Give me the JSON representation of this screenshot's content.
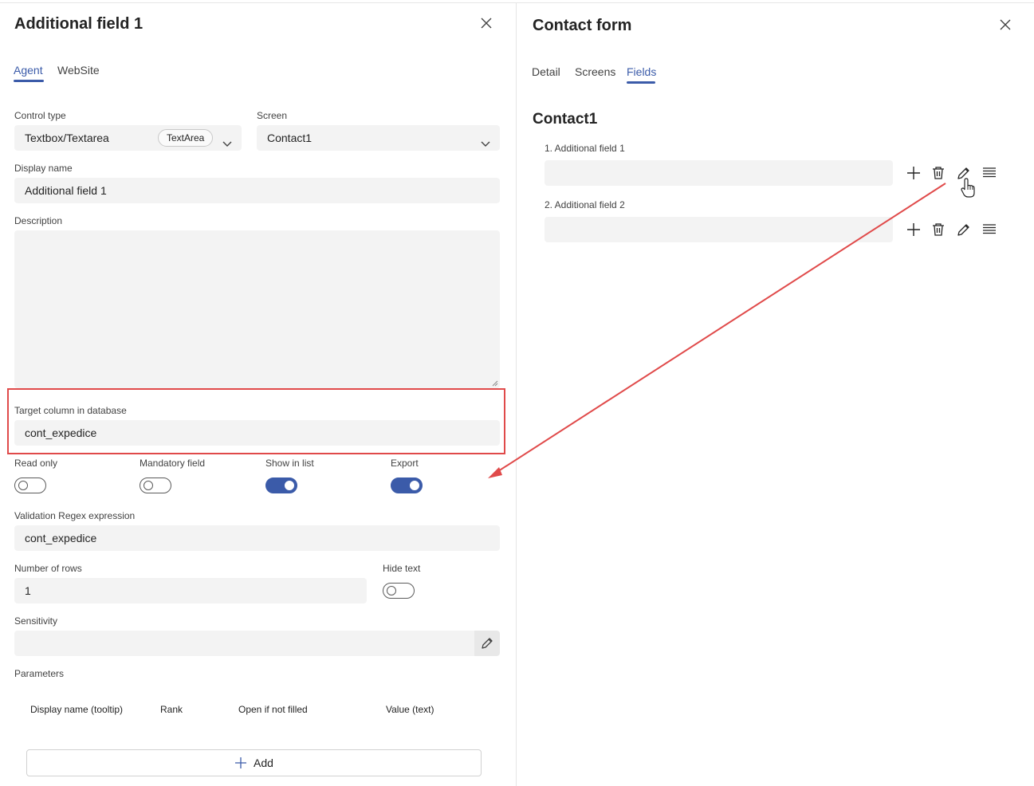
{
  "left_panel": {
    "title": "Additional field 1",
    "tabs": [
      {
        "label": "Agent",
        "active": true
      },
      {
        "label": "WebSite",
        "active": false
      }
    ],
    "control_type": {
      "label": "Control type",
      "value": "Textbox/Textarea",
      "chip": "TextArea"
    },
    "screen": {
      "label": "Screen",
      "value": "Contact1"
    },
    "display_name": {
      "label": "Display name",
      "value": "Additional field 1"
    },
    "description": {
      "label": "Description",
      "value": ""
    },
    "target_column": {
      "label": "Target column in database",
      "value": "cont_expedice"
    },
    "toggles": [
      {
        "label": "Read only",
        "on": false
      },
      {
        "label": "Mandatory field",
        "on": false
      },
      {
        "label": "Show in list",
        "on": true
      },
      {
        "label": "Export",
        "on": true
      }
    ],
    "validation": {
      "label": "Validation Regex expression",
      "value": "cont_expedice"
    },
    "rows": {
      "label": "Number of rows",
      "value": "1"
    },
    "hide_text": {
      "label": "Hide text",
      "on": false
    },
    "sensitivity": {
      "label": "Sensitivity",
      "value": ""
    },
    "parameters": {
      "label": "Parameters",
      "columns": [
        "Display name (tooltip)",
        "Rank",
        "Open if not filled",
        "Value (text)"
      ],
      "add_label": "Add"
    }
  },
  "right_panel": {
    "title": "Contact form",
    "tabs": [
      {
        "label": "Detail",
        "active": false
      },
      {
        "label": "Screens",
        "active": false
      },
      {
        "label": "Fields",
        "active": true
      }
    ],
    "section": "Contact1",
    "fields": [
      {
        "label": "1. Additional field 1"
      },
      {
        "label": "2. Additional field 2"
      }
    ]
  },
  "colors": {
    "accent": "#3b5ba9",
    "annotation": "#e04a4a",
    "field_bg": "#f3f3f3"
  },
  "icons": [
    "close-icon",
    "chevron-down-icon",
    "pencil-icon",
    "plus-icon",
    "trash-icon",
    "reorder-icon",
    "hand-cursor-icon"
  ]
}
